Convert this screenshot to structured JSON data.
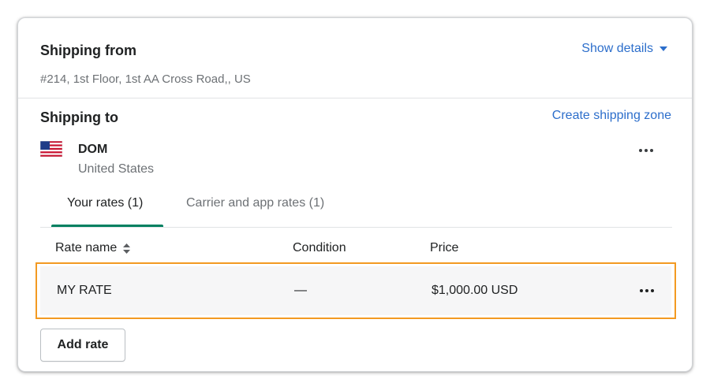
{
  "shipping_from": {
    "title": "Shipping from",
    "address": "#214, 1st Floor, 1st AA Cross Road,, US",
    "show_details_label": "Show details"
  },
  "shipping_to": {
    "title": "Shipping to",
    "create_zone_label": "Create shipping zone",
    "zone": {
      "name": "DOM",
      "country": "United States"
    }
  },
  "tabs": [
    {
      "label": "Your rates (1)",
      "active": true
    },
    {
      "label": "Carrier and app rates (1)",
      "active": false
    }
  ],
  "table": {
    "columns": [
      "Rate name",
      "Condition",
      "Price"
    ],
    "rows": [
      {
        "name": "MY RATE",
        "condition": "—",
        "price": "$1,000.00 USD"
      }
    ]
  },
  "add_rate_label": "Add rate",
  "colors": {
    "link": "#2c6ecb",
    "tab_accent": "#008060",
    "highlight": "#f39a22"
  },
  "icons": [
    "caret-down-icon",
    "us-flag-icon",
    "more-actions-icon",
    "sort-icon"
  ]
}
